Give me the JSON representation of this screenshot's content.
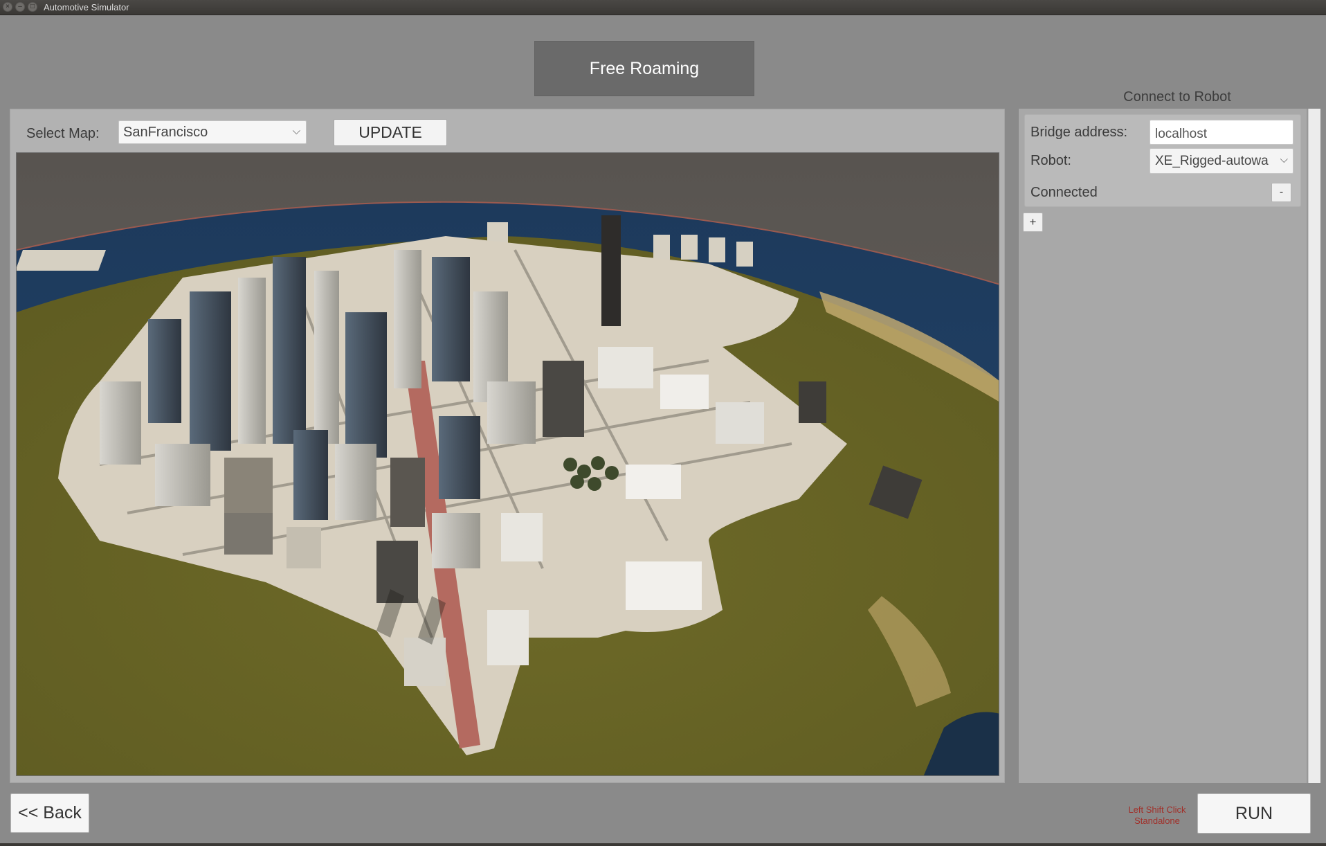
{
  "window": {
    "title": "Automotive Simulator",
    "controls": [
      "×",
      "–",
      "□"
    ]
  },
  "mode_button": {
    "label": "Free Roaming"
  },
  "map_panel": {
    "select_label": "Select Map:",
    "selected_map": "SanFrancisco",
    "update_label": "UPDATE",
    "preview_alt": "SanFrancisco"
  },
  "robot_panel": {
    "heading": "Connect to Robot",
    "bridge_label": "Bridge address:",
    "bridge_value": "localhost",
    "robot_label": "Robot:",
    "robot_value": "XE_Rigged-autowa",
    "status": "Connected",
    "remove_label": "-",
    "add_label": "+"
  },
  "bottom": {
    "back_label": "<< Back",
    "hint_line1": "Left Shift Click",
    "hint_line2": "Standalone",
    "run_label": "RUN"
  },
  "icons": {
    "dropdown": "chevron-down-icon"
  },
  "colors": {
    "background": "#8a8a8a",
    "panel": "#b2b2b2",
    "hint": "#a0302a",
    "mode_button": "#6a6a6a"
  }
}
